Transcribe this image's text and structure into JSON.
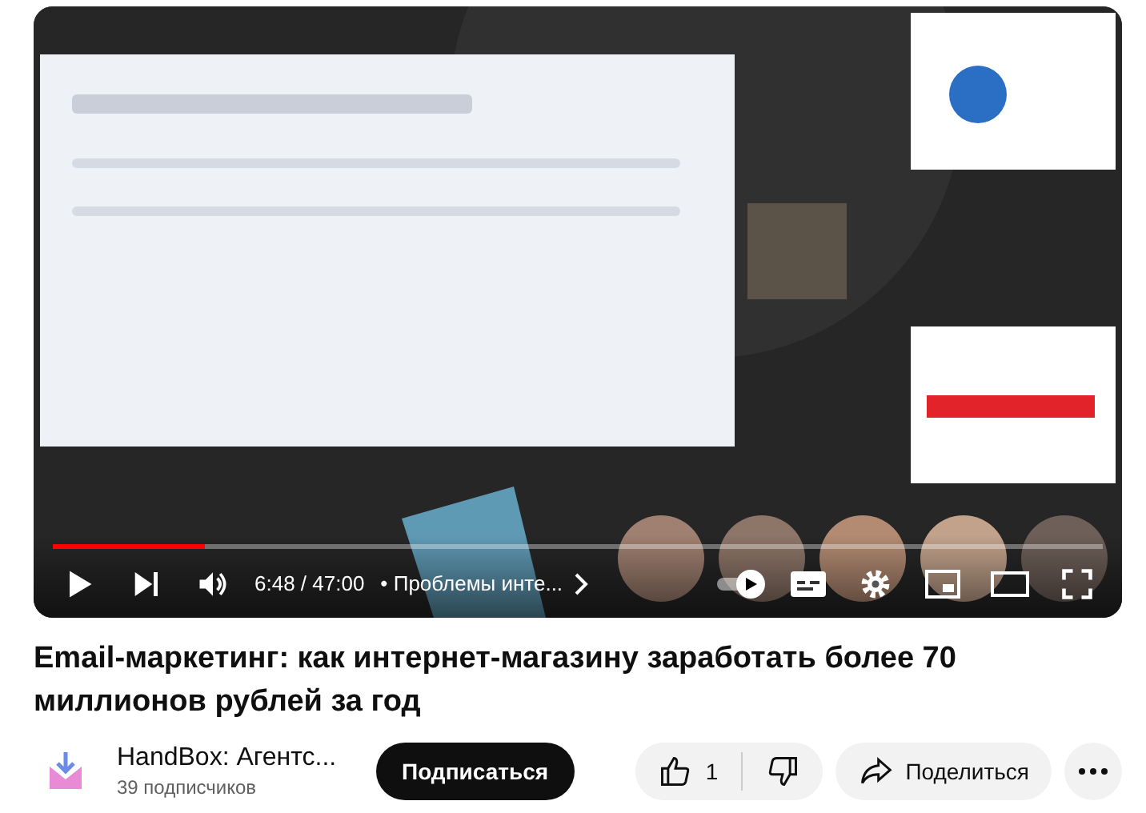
{
  "player": {
    "kind": "picture",
    "progress": {
      "level": 0.145
    },
    "time": "6:48 / 47:00",
    "chapter": "Проблемы инте...",
    "chapter_separator": "•",
    "paused": true,
    "muted": false
  },
  "video_title": "Email-маркетинг: как интернет-магазину заработать более 70 миллионов рублей за год",
  "channel": {
    "name": "HandBox: Агентс...",
    "subscribers": "39 подписчиков",
    "subscribe_label": "Подписаться"
  },
  "likes": {
    "count": "1"
  },
  "share_label": "Поделиться"
}
